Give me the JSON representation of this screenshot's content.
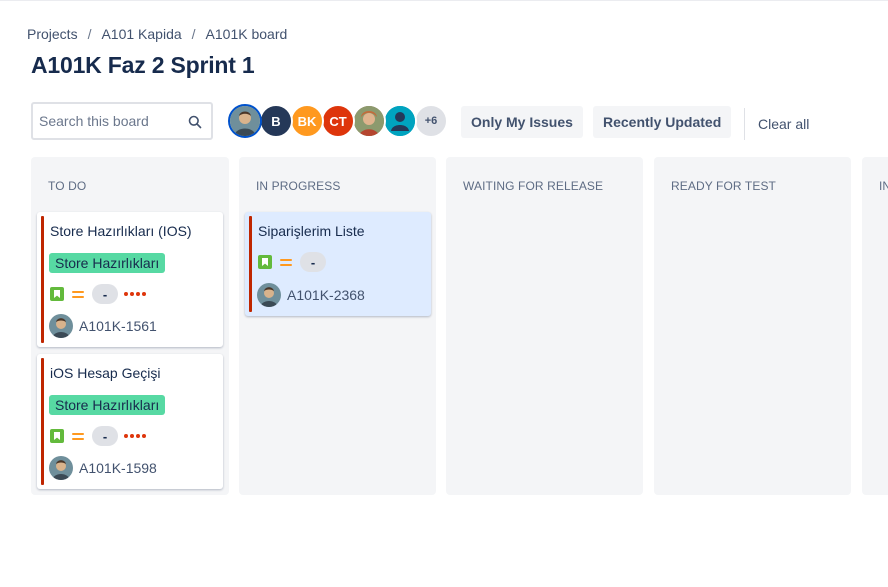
{
  "breadcrumb": [
    "Projects",
    "A101 Kapida",
    "A101K board"
  ],
  "breadcrumb_separator": "/",
  "title": "A101K Faz 2 Sprint 1",
  "search": {
    "placeholder": "Search this board",
    "value": ""
  },
  "avatars": [
    {
      "type": "photo",
      "color": "#5e7d8a",
      "selected": true
    },
    {
      "type": "initials",
      "text": "B",
      "color": "#253858"
    },
    {
      "type": "initials",
      "text": "BK",
      "color": "#ff991f"
    },
    {
      "type": "initials",
      "text": "CT",
      "color": "#de350b"
    },
    {
      "type": "photo",
      "color": "#a07a55"
    },
    {
      "type": "default-user",
      "color": "#00a3bf"
    },
    {
      "type": "more",
      "text": "+6",
      "color": "#dfe1e6"
    }
  ],
  "toolbar": {
    "only_my_issues": "Only My Issues",
    "recently_updated": "Recently Updated",
    "clear_all": "Clear all"
  },
  "columns": [
    {
      "name": "TO DO"
    },
    {
      "name": "IN PROGRESS"
    },
    {
      "name": "WAITING FOR RELEASE"
    },
    {
      "name": "READY FOR TEST"
    },
    {
      "name": "IN"
    }
  ],
  "cards": {
    "card1": {
      "summary": "Store Hazırlıkları (IOS)",
      "epic": "Store Hazırlıkları",
      "estimate": "-",
      "key": "A101K-1561",
      "issue_type": "story",
      "priority": "medium"
    },
    "card2": {
      "summary": "iOS Hesap Geçişi",
      "epic": "Store Hazırlıkları",
      "estimate": "-",
      "key": "A101K-1598",
      "issue_type": "story",
      "priority": "medium"
    },
    "card3": {
      "summary": "Siparişlerim Liste",
      "estimate": "-",
      "key": "A101K-2368",
      "issue_type": "story",
      "priority": "medium"
    }
  },
  "colors": {
    "flag_bar": "#bf2600",
    "epic_label": "#57d9a3",
    "story_icon": "#63ba3c",
    "priority": "#ff991f",
    "highlight_card": "#deebff"
  }
}
